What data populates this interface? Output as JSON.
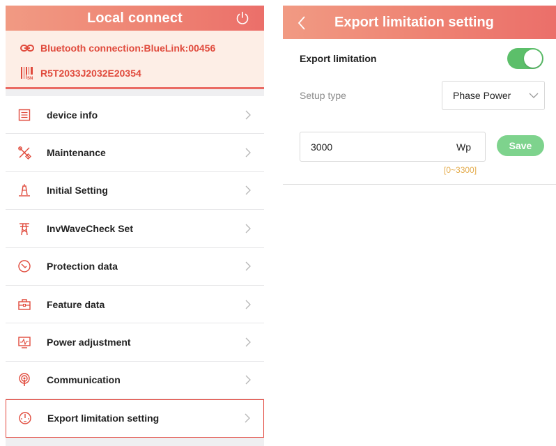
{
  "left": {
    "header_title": "Local connect",
    "bluetooth_text": "Bluetooth connection:BlueLink:00456",
    "serial_number": "R5T2033J2032E20354",
    "menu": [
      {
        "label": "device info",
        "icon": "list-icon"
      },
      {
        "label": "Maintenance",
        "icon": "tools-icon"
      },
      {
        "label": "Initial Setting",
        "icon": "initial-setting-icon"
      },
      {
        "label": "InvWaveCheck Set",
        "icon": "tower-icon"
      },
      {
        "label": "Protection data",
        "icon": "gauge-icon"
      },
      {
        "label": "Feature data",
        "icon": "briefcase-icon"
      },
      {
        "label": "Power adjustment",
        "icon": "monitor-icon"
      },
      {
        "label": "Communication",
        "icon": "signal-icon"
      },
      {
        "label": "Export limitation setting",
        "icon": "speedometer-icon",
        "selected": true
      }
    ]
  },
  "right": {
    "header_title": "Export limitation setting",
    "export_limitation_label": "Export limitation",
    "export_limitation_enabled": true,
    "setup_type_label": "Setup type",
    "setup_type_value": "Phase Power",
    "power_value": "3000",
    "power_unit": "Wp",
    "save_label": "Save",
    "range_hint": "[0~3300]"
  },
  "colors": {
    "header_gradient_start": "#f19a83",
    "header_gradient_end": "#eb6f6a",
    "accent_red": "#e04a3c",
    "toggle_green": "#5cbf6a",
    "save_green": "#7ed38d",
    "range_orange": "#e4ab4b"
  }
}
